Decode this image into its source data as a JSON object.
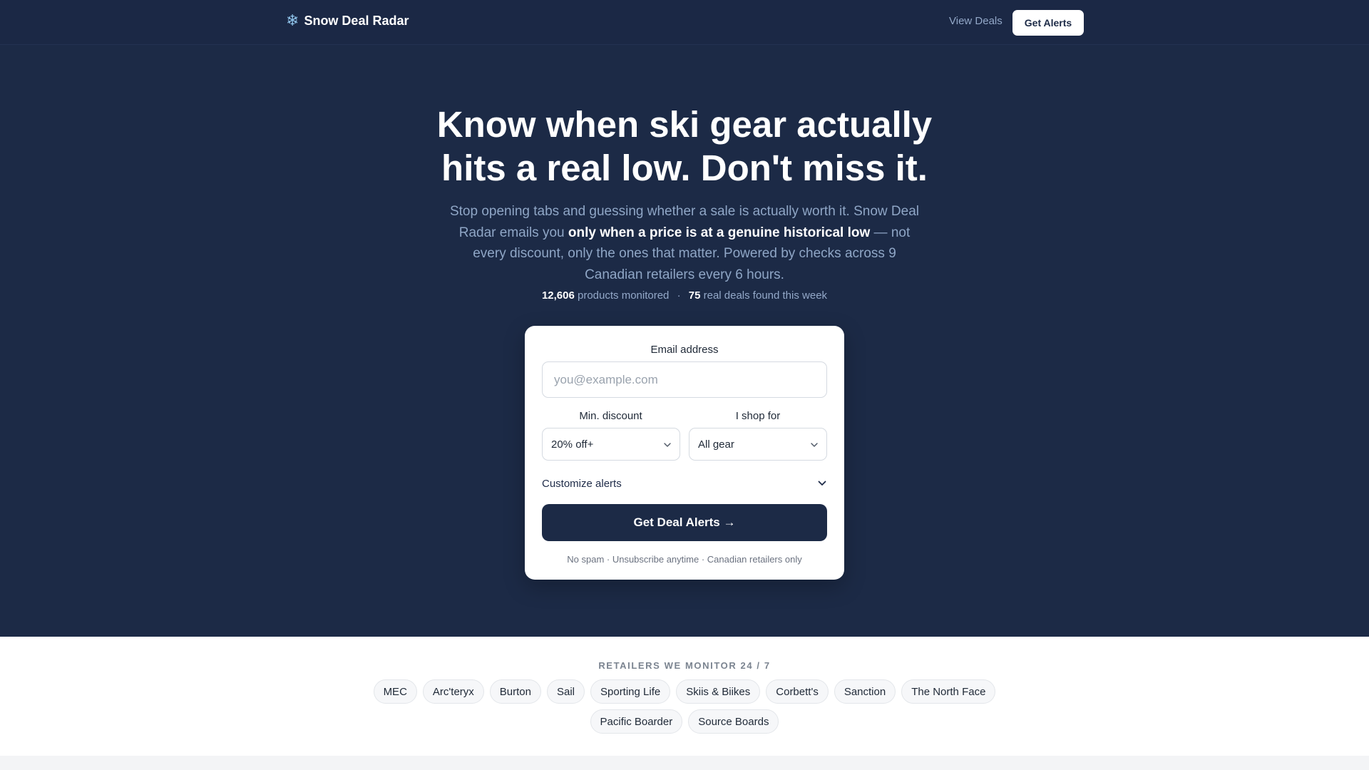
{
  "brand": {
    "icon": "snowflake-icon",
    "name": "Snow Deal Radar"
  },
  "nav": {
    "view_deals": "View Deals",
    "get_alerts": "Get Alerts"
  },
  "hero": {
    "headline_line1": "Know when ski gear actually",
    "headline_line2": "hits a real low. Don't miss it.",
    "sub_before": "Stop opening tabs and guessing whether a sale is actually worth it. Snow Deal Radar emails you ",
    "sub_bold": "only when a price is at a genuine historical low",
    "sub_after": " — not every discount, only the ones that matter. Powered by checks across 9 Canadian retailers every 6 hours.",
    "stats": {
      "products_count": "12,606",
      "products_label": " products monitored",
      "separator": "·",
      "deals_count": "75",
      "deals_label": " real deals found this week"
    }
  },
  "form": {
    "email_label": "Email address",
    "email_placeholder": "you@example.com",
    "email_value": "",
    "discount_label": "Min. discount",
    "discount_selected": "20% off+",
    "shop_label": "I shop for",
    "shop_selected": "All gear",
    "customize_label": "Customize alerts",
    "submit_label": "Get Deal Alerts →",
    "fine_print": "No spam · Unsubscribe anytime · Canadian retailers only"
  },
  "retailers": {
    "title": "RETAILERS WE MONITOR 24 / 7",
    "items": [
      "MEC",
      "Arc'teryx",
      "Burton",
      "Sail",
      "Sporting Life",
      "Skiis & Biikes",
      "Corbett's",
      "Sanction",
      "The North Face",
      "Pacific Boarder",
      "Source Boards"
    ]
  },
  "colors": {
    "navy": "#1c2a46",
    "muted_blue": "#8fa6c6",
    "accent_icon": "#8fc3ea"
  }
}
